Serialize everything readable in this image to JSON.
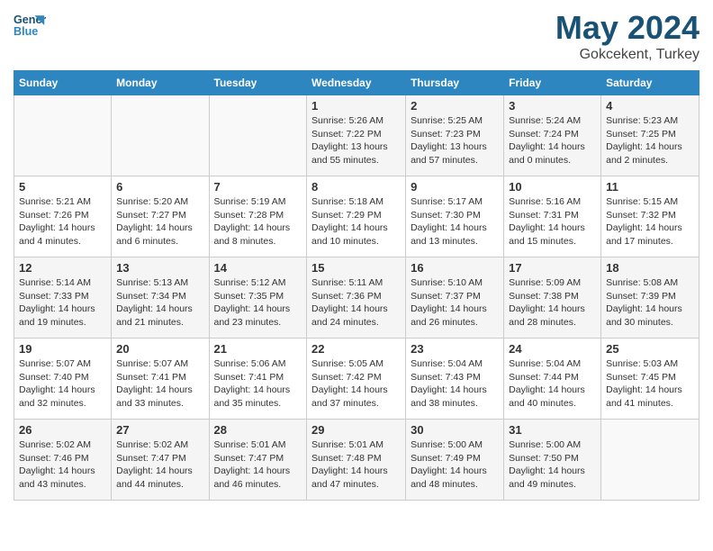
{
  "header": {
    "logo_line1": "General",
    "logo_line2": "Blue",
    "month": "May 2024",
    "location": "Gokcekent, Turkey"
  },
  "weekdays": [
    "Sunday",
    "Monday",
    "Tuesday",
    "Wednesday",
    "Thursday",
    "Friday",
    "Saturday"
  ],
  "weeks": [
    [
      {
        "day": "",
        "info": ""
      },
      {
        "day": "",
        "info": ""
      },
      {
        "day": "",
        "info": ""
      },
      {
        "day": "1",
        "info": "Sunrise: 5:26 AM\nSunset: 7:22 PM\nDaylight: 13 hours\nand 55 minutes."
      },
      {
        "day": "2",
        "info": "Sunrise: 5:25 AM\nSunset: 7:23 PM\nDaylight: 13 hours\nand 57 minutes."
      },
      {
        "day": "3",
        "info": "Sunrise: 5:24 AM\nSunset: 7:24 PM\nDaylight: 14 hours\nand 0 minutes."
      },
      {
        "day": "4",
        "info": "Sunrise: 5:23 AM\nSunset: 7:25 PM\nDaylight: 14 hours\nand 2 minutes."
      }
    ],
    [
      {
        "day": "5",
        "info": "Sunrise: 5:21 AM\nSunset: 7:26 PM\nDaylight: 14 hours\nand 4 minutes."
      },
      {
        "day": "6",
        "info": "Sunrise: 5:20 AM\nSunset: 7:27 PM\nDaylight: 14 hours\nand 6 minutes."
      },
      {
        "day": "7",
        "info": "Sunrise: 5:19 AM\nSunset: 7:28 PM\nDaylight: 14 hours\nand 8 minutes."
      },
      {
        "day": "8",
        "info": "Sunrise: 5:18 AM\nSunset: 7:29 PM\nDaylight: 14 hours\nand 10 minutes."
      },
      {
        "day": "9",
        "info": "Sunrise: 5:17 AM\nSunset: 7:30 PM\nDaylight: 14 hours\nand 13 minutes."
      },
      {
        "day": "10",
        "info": "Sunrise: 5:16 AM\nSunset: 7:31 PM\nDaylight: 14 hours\nand 15 minutes."
      },
      {
        "day": "11",
        "info": "Sunrise: 5:15 AM\nSunset: 7:32 PM\nDaylight: 14 hours\nand 17 minutes."
      }
    ],
    [
      {
        "day": "12",
        "info": "Sunrise: 5:14 AM\nSunset: 7:33 PM\nDaylight: 14 hours\nand 19 minutes."
      },
      {
        "day": "13",
        "info": "Sunrise: 5:13 AM\nSunset: 7:34 PM\nDaylight: 14 hours\nand 21 minutes."
      },
      {
        "day": "14",
        "info": "Sunrise: 5:12 AM\nSunset: 7:35 PM\nDaylight: 14 hours\nand 23 minutes."
      },
      {
        "day": "15",
        "info": "Sunrise: 5:11 AM\nSunset: 7:36 PM\nDaylight: 14 hours\nand 24 minutes."
      },
      {
        "day": "16",
        "info": "Sunrise: 5:10 AM\nSunset: 7:37 PM\nDaylight: 14 hours\nand 26 minutes."
      },
      {
        "day": "17",
        "info": "Sunrise: 5:09 AM\nSunset: 7:38 PM\nDaylight: 14 hours\nand 28 minutes."
      },
      {
        "day": "18",
        "info": "Sunrise: 5:08 AM\nSunset: 7:39 PM\nDaylight: 14 hours\nand 30 minutes."
      }
    ],
    [
      {
        "day": "19",
        "info": "Sunrise: 5:07 AM\nSunset: 7:40 PM\nDaylight: 14 hours\nand 32 minutes."
      },
      {
        "day": "20",
        "info": "Sunrise: 5:07 AM\nSunset: 7:41 PM\nDaylight: 14 hours\nand 33 minutes."
      },
      {
        "day": "21",
        "info": "Sunrise: 5:06 AM\nSunset: 7:41 PM\nDaylight: 14 hours\nand 35 minutes."
      },
      {
        "day": "22",
        "info": "Sunrise: 5:05 AM\nSunset: 7:42 PM\nDaylight: 14 hours\nand 37 minutes."
      },
      {
        "day": "23",
        "info": "Sunrise: 5:04 AM\nSunset: 7:43 PM\nDaylight: 14 hours\nand 38 minutes."
      },
      {
        "day": "24",
        "info": "Sunrise: 5:04 AM\nSunset: 7:44 PM\nDaylight: 14 hours\nand 40 minutes."
      },
      {
        "day": "25",
        "info": "Sunrise: 5:03 AM\nSunset: 7:45 PM\nDaylight: 14 hours\nand 41 minutes."
      }
    ],
    [
      {
        "day": "26",
        "info": "Sunrise: 5:02 AM\nSunset: 7:46 PM\nDaylight: 14 hours\nand 43 minutes."
      },
      {
        "day": "27",
        "info": "Sunrise: 5:02 AM\nSunset: 7:47 PM\nDaylight: 14 hours\nand 44 minutes."
      },
      {
        "day": "28",
        "info": "Sunrise: 5:01 AM\nSunset: 7:47 PM\nDaylight: 14 hours\nand 46 minutes."
      },
      {
        "day": "29",
        "info": "Sunrise: 5:01 AM\nSunset: 7:48 PM\nDaylight: 14 hours\nand 47 minutes."
      },
      {
        "day": "30",
        "info": "Sunrise: 5:00 AM\nSunset: 7:49 PM\nDaylight: 14 hours\nand 48 minutes."
      },
      {
        "day": "31",
        "info": "Sunrise: 5:00 AM\nSunset: 7:50 PM\nDaylight: 14 hours\nand 49 minutes."
      },
      {
        "day": "",
        "info": ""
      }
    ]
  ]
}
